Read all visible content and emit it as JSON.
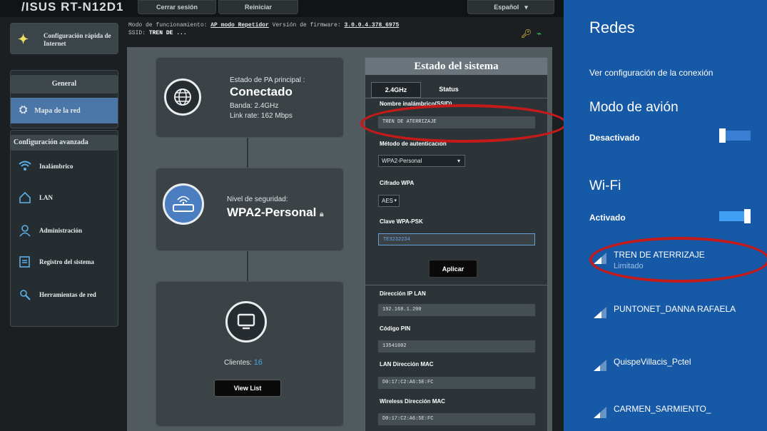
{
  "router": {
    "brand": "/ISUS  RT-N12D1",
    "top_buttons": [
      "Cerrar sesión",
      "Reiniciar",
      "Español"
    ],
    "quick_setup": "Configuración rápida de Internet",
    "general_label": "General",
    "network_map_label": "Mapa de la red",
    "advanced_label": "Configuración avanzada",
    "nav_items": [
      "Inalámbrico",
      "LAN",
      "Administración",
      "Registro del sistema",
      "Herramientas de red"
    ],
    "info": {
      "mode_prefix": "Modo de funcionamiento:",
      "mode_value": "AP modo Repetidor",
      "firmware_prefix": "Versión de firmware:",
      "firmware_value": "3.0.0.4.378_6975",
      "ssid_prefix": "SSID:",
      "ssid_value": "TREN DE ..."
    },
    "ap_card": {
      "status_label": "Estado de PA principal :",
      "status_value": "Conectado",
      "band": "Banda: 2.4GHz",
      "link": "Link rate: 162 Mbps"
    },
    "security_card": {
      "label": "Nivel de seguridad:",
      "value": "WPA2-Personal"
    },
    "clients_card": {
      "label": "Clientes:",
      "count": "16",
      "button": "View List"
    },
    "panel": {
      "title": "Estado del sistema",
      "tabs": [
        "2.4GHz",
        "Status"
      ],
      "ssid_label": "Nombre inalámbrico(SSID)",
      "ssid_value": "TREN DE ATERRIZAJE",
      "auth_label": "Método de autenticación",
      "auth_value": "WPA2-Personal",
      "wpa_label": "Cifrado WPA",
      "wpa_value": "AES",
      "psk_label": "Clave WPA-PSK",
      "psk_value": "TE3232234",
      "apply": "Aplicar",
      "lan_ip_label": "Dirección IP LAN",
      "lan_ip_value": "192.168.1.200",
      "pin_label": "Código PIN",
      "pin_value": "13541002",
      "lan_mac_label": "LAN Dirección MAC",
      "lan_mac_value": "D0:17:C2:A6:5E:FC",
      "wl_mac_label": "Wireless Dirección MAC",
      "wl_mac_value": "D0:17:C2:A6:5E:FC"
    }
  },
  "windows": {
    "title": "Redes",
    "view_link": "Ver configuración de la conexión",
    "airplane_title": "Modo de avión",
    "airplane_state": "Desactivado",
    "wifi_title": "Wi-Fi",
    "wifi_state": "Activado",
    "networks": [
      {
        "name": "TREN DE ATERRIZAJE",
        "status": "Limitado"
      },
      {
        "name": "PUNTONET_DANNA RAFAELA",
        "status": ""
      },
      {
        "name": "QuispeVillacis_Pctel",
        "status": ""
      },
      {
        "name": "CARMEN_SARMIENTO_",
        "status": ""
      }
    ]
  },
  "colors": {
    "win_blue": "#1659a6",
    "accent_red": "#c41a1a",
    "router_bg": "#1b1f22"
  }
}
